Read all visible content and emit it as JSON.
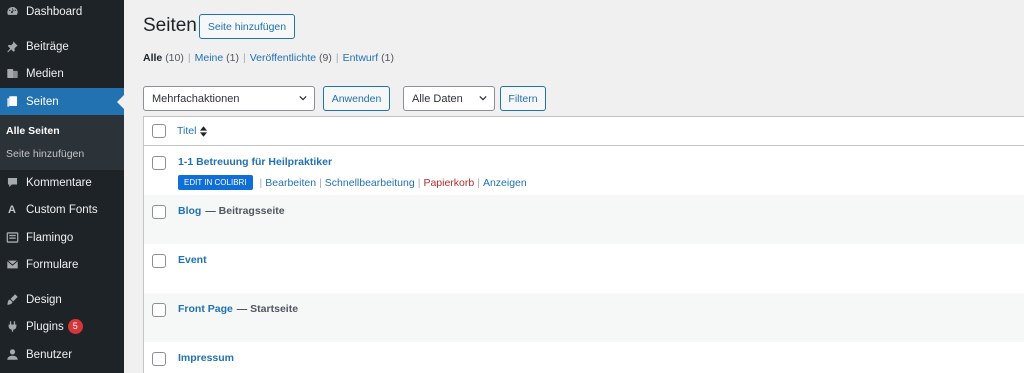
{
  "sidebar": {
    "items": [
      {
        "label": "Dashboard",
        "icon": "dashboard-icon"
      },
      {
        "label": "Beiträge",
        "icon": "pin-icon"
      },
      {
        "label": "Medien",
        "icon": "media-icon"
      },
      {
        "label": "Seiten",
        "icon": "pages-icon"
      },
      {
        "label": "Kommentare",
        "icon": "comment-icon"
      },
      {
        "label": "Custom Fonts",
        "icon": "font-icon"
      },
      {
        "label": "Flamingo",
        "icon": "flamingo-icon"
      },
      {
        "label": "Formulare",
        "icon": "mail-icon"
      },
      {
        "label": "Design",
        "icon": "brush-icon"
      },
      {
        "label": "Plugins",
        "icon": "plugin-icon",
        "badge": "5"
      },
      {
        "label": "Benutzer",
        "icon": "user-icon"
      }
    ],
    "submenu": [
      {
        "label": "Alle Seiten"
      },
      {
        "label": "Seite hinzufügen"
      }
    ]
  },
  "header": {
    "title": "Seiten",
    "add_button": "Seite hinzufügen"
  },
  "views": [
    {
      "label": "Alle",
      "count": "(10)"
    },
    {
      "label": "Meine",
      "count": "(1)"
    },
    {
      "label": "Veröffentlichte",
      "count": "(9)"
    },
    {
      "label": "Entwurf",
      "count": "(1)"
    }
  ],
  "filters": {
    "bulk_select": "Mehrfachaktionen",
    "apply_button": "Anwenden",
    "date_select": "Alle Daten",
    "filter_button": "Filtern"
  },
  "table": {
    "column_title": "Titel",
    "rows": [
      {
        "title": "1-1 Betreuung für Heilpraktiker",
        "state": ""
      },
      {
        "title": "Blog",
        "state": "— Beitragsseite"
      },
      {
        "title": "Event",
        "state": ""
      },
      {
        "title": "Front Page",
        "state": "— Startseite"
      },
      {
        "title": "Impressum",
        "state": ""
      }
    ],
    "row_actions": {
      "colibri": "EDIT IN COLIBRI",
      "edit": "Bearbeiten",
      "quick_edit": "Schnellbearbeitung",
      "trash": "Papierkorb",
      "view": "Anzeigen"
    }
  },
  "colors": {
    "sidebar_bg": "#1d2327",
    "accent": "#2271b1",
    "trash": "#b32d2e",
    "badge": "#d63638"
  }
}
